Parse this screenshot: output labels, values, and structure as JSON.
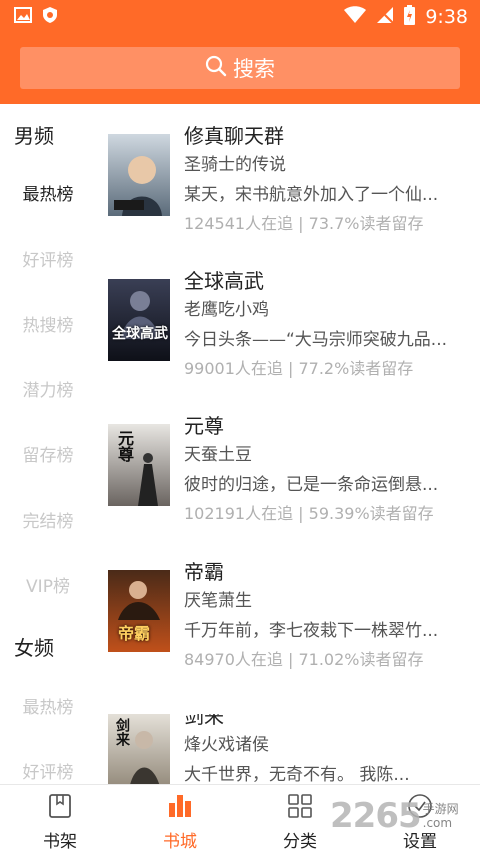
{
  "status_bar": {
    "time": "9:38"
  },
  "search": {
    "label": "搜索"
  },
  "sidebar": {
    "sections": [
      {
        "heading": "男频",
        "items": [
          "最热榜",
          "好评榜",
          "热搜榜",
          "潜力榜",
          "留存榜",
          "完结榜",
          "VIP榜"
        ],
        "active_index": 0
      },
      {
        "heading": "女频",
        "items": [
          "最热榜",
          "好评榜"
        ]
      }
    ]
  },
  "books": [
    {
      "title": "修真聊天群",
      "author": "圣骑士的传说",
      "desc": "某天，宋书航意外加入了一个仙...",
      "stats": "124541人在追 | 73.7%读者留存",
      "cover_text": "",
      "cover_colors": [
        "#cfd8e0",
        "#5b6b7a"
      ]
    },
    {
      "title": "全球高武",
      "author": "老鹰吃小鸡",
      "desc": "今日头条——“大马宗师突破九品...",
      "stats": "99001人在追 | 77.2%读者留存",
      "cover_text": "全球高武",
      "cover_colors": [
        "#3a3f55",
        "#0e1018"
      ]
    },
    {
      "title": "元尊",
      "author": "天蚕土豆",
      "desc": "彼时的归途，已是一条命运倒悬...",
      "stats": "102191人在追 | 59.39%读者留存",
      "cover_text": "元尊",
      "cover_colors": [
        "#e8e6e2",
        "#6a6460"
      ]
    },
    {
      "title": "帝霸",
      "author": "厌笔萧生",
      "desc": "千万年前，李七夜栽下一株翠竹...",
      "stats": "84970人在追 | 71.02%读者留存",
      "cover_text": "帝霸",
      "cover_colors": [
        "#4a2a18",
        "#c0501a"
      ]
    },
    {
      "title": "剑来",
      "author": "烽火戏诸侯",
      "desc": "大千世界，无奇不有。 我陈...",
      "stats": "",
      "cover_text": "剑来",
      "cover_colors": [
        "#e4e0d8",
        "#8a8070"
      ]
    }
  ],
  "tabs": [
    {
      "label": "书架",
      "icon": "bookmark-icon",
      "active": false
    },
    {
      "label": "书城",
      "icon": "bar-chart-icon",
      "active": true
    },
    {
      "label": "分类",
      "icon": "grid-icon",
      "active": false
    },
    {
      "label": "设置",
      "icon": "settings-icon",
      "active": false
    }
  ],
  "watermark": {
    "number": "2265",
    "sub": "手游网",
    "domain": ".com"
  },
  "colors": {
    "accent": "#ff6a28",
    "search_bg": "#ff9064"
  }
}
